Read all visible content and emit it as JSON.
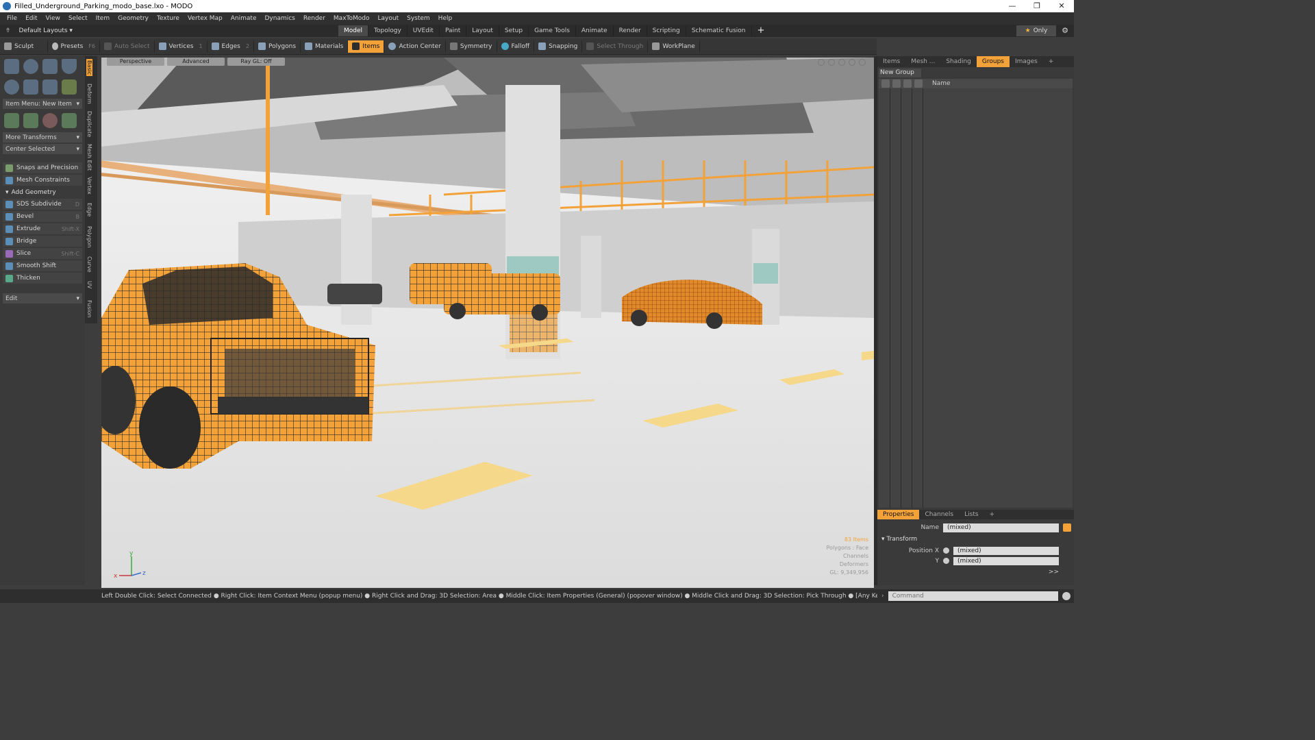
{
  "window": {
    "title": "Filled_Underground_Parking_modo_base.lxo - MODO",
    "min": "—",
    "restore": "❐",
    "close": "✕"
  },
  "menu": [
    "File",
    "Edit",
    "View",
    "Select",
    "Item",
    "Geometry",
    "Texture",
    "Vertex Map",
    "Animate",
    "Dynamics",
    "Render",
    "MaxToModo",
    "Layout",
    "System",
    "Help"
  ],
  "layouts": {
    "label": "Default Layouts ▾",
    "tabs": [
      "Model",
      "Topology",
      "UVEdit",
      "Paint",
      "Layout",
      "Setup",
      "Game Tools",
      "Animate",
      "Render",
      "Scripting",
      "Schematic Fusion"
    ],
    "active": "Model",
    "only": "Only"
  },
  "toolbar": {
    "sculpt": "Sculpt",
    "presets": "Presets",
    "presets_key": "F6",
    "auto_select": "Auto Select",
    "vertices": "Vertices",
    "vertices_key": "1",
    "edges": "Edges",
    "edges_key": "2",
    "polygons": "Polygons",
    "materials": "Materials",
    "items": "Items",
    "action_center": "Action Center",
    "symmetry": "Symmetry",
    "falloff": "Falloff",
    "snapping": "Snapping",
    "select_through": "Select Through",
    "workplane": "WorkPlane"
  },
  "left": {
    "item_menu": "Item Menu: New Item",
    "more_transforms": "More Transforms",
    "center_selected": "Center Selected",
    "snaps": "Snaps and Precision",
    "mesh_constraints": "Mesh Constraints",
    "add_geometry": "Add Geometry",
    "tools": [
      {
        "label": "SDS Subdivide",
        "key": "D"
      },
      {
        "label": "Bevel",
        "key": "B"
      },
      {
        "label": "Extrude",
        "key": "Shift-X"
      },
      {
        "label": "Bridge",
        "key": ""
      },
      {
        "label": "Slice",
        "key": "Shift-C"
      },
      {
        "label": "Smooth Shift",
        "key": ""
      },
      {
        "label": "Thicken",
        "key": ""
      }
    ],
    "edit": "Edit"
  },
  "sidetabs": [
    "Basic",
    "Deform",
    "Duplicate",
    "Mesh Edit",
    "Vertex",
    "Edge",
    "Polygon",
    "Curve",
    "UV",
    "Fusion"
  ],
  "viewport": {
    "tabs": [
      "Perspective",
      "Advanced",
      "Ray GL: Off"
    ],
    "stats": [
      "83 Items",
      "Polygons : Face",
      "Channels",
      "Deformers",
      "GL: 9,349,956"
    ],
    "axes": {
      "x": "x",
      "y": "y",
      "z": "z"
    }
  },
  "right": {
    "tabs": [
      "Items",
      "Mesh ...",
      "Shading",
      "Groups",
      "Images",
      "+"
    ],
    "active": "Groups",
    "new_group": "New Group",
    "col_name": "Name",
    "prop_tabs": [
      "Properties",
      "Channels",
      "Lists",
      "+"
    ],
    "prop_active": "Properties",
    "name_label": "Name",
    "name_value": "(mixed)",
    "transform": "Transform",
    "posx_label": "Position X",
    "posx_value": "(mixed)",
    "y_label": "Y",
    "y_value": "(mixed)",
    "more": ">>"
  },
  "command": {
    "placeholder": "Command"
  },
  "status": "Left Double Click: Select Connected ● Right Click: Item Context Menu (popup menu) ● Right Click and Drag: 3D Selection: Area ● Middle Click: Item Properties (General) (popover window) ● Middle Click and Drag: 3D Selection: Pick Through ● [Any Key]-[Any Button] Click and Drag: ..."
}
